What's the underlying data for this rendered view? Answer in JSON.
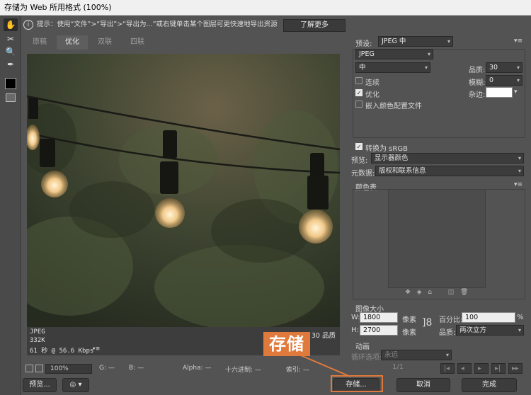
{
  "window": {
    "title": "存储为 Web 所用格式 (100%)"
  },
  "hint": {
    "icon": "info-circle-icon",
    "text": "提示：使用“文件”>“导出”>“导出为...”或右键单击某个图层可更快速地导出资源",
    "learn_more": "了解更多"
  },
  "tabs": [
    {
      "label": "原稿"
    },
    {
      "label": "优化"
    },
    {
      "label": "双联"
    },
    {
      "label": "四联"
    }
  ],
  "preview_info": {
    "format": "JPEG",
    "size": "332K",
    "time": "61 秒 @ 56.6 Kbps",
    "quality": "30 品质"
  },
  "status": {
    "zoom": "100%",
    "g": "G: —",
    "b": "B: —",
    "alpha": "Alpha: —",
    "hex": "十六进制: —",
    "index": "索引: —"
  },
  "settings": {
    "preset_label": "预设:",
    "preset_value": "JPEG 中",
    "format_value": "JPEG",
    "level_value": "中",
    "quality_label": "品质:",
    "quality_value": "30",
    "progressive_label": "连续",
    "blur_label": "模糊:",
    "blur_value": "0",
    "optimized_label": "优化",
    "matte_label": "杂边:",
    "embed_profile_label": "嵌入颜色配置文件",
    "convert_srgb_label": "转换为 sRGB",
    "preview_label": "预览:",
    "preview_value": "显示器颜色",
    "metadata_label": "元数据:",
    "metadata_value": "版权和联系信息",
    "color_table_label": "颜色表"
  },
  "image_size": {
    "title": "图像大小",
    "w_label": "W:",
    "w_value": "1800",
    "h_label": "H:",
    "h_value": "2700",
    "unit": "像素",
    "percent_label": "百分比:",
    "percent_value": "100",
    "percent_unit": "%",
    "quality_label": "品质:",
    "quality_value": "两次立方"
  },
  "animation": {
    "title": "动画",
    "loop_label": "循环选项:",
    "loop_value": "永远",
    "frame": "1/1"
  },
  "footer": {
    "preview": "预览...",
    "save": "存储...",
    "cancel": "取消",
    "done": "完成"
  },
  "annotation": {
    "label": "存储"
  },
  "colors": {
    "accent": "#e07a3c",
    "panel": "#535353",
    "dark": "#3c3c3c"
  }
}
